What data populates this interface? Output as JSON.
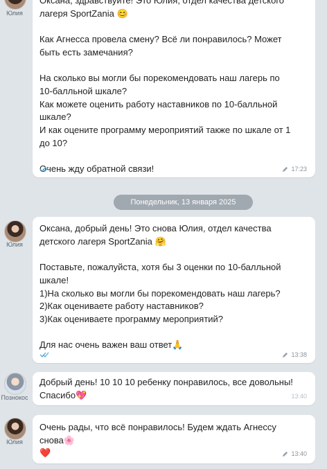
{
  "messages": [
    {
      "author": "Юлия",
      "text": "Оксана, здравствуйте! Это Юлия, отдел качества детского\nлагеря SportZania 😊\n\nКак Агнесса провела смену? Всё ли понравилось? Может\nбыть есть замечания?\n\nНа сколько вы могли бы порекомендовать наш лагерь по\n10-балльной шкале?\nКак можете оценить работу наставников по 10-балльной\nшкале?\nИ как оцените программу мероприятий также по шкале от 1\nдо 10?\n\nОчень жду обратной связи!",
      "time": "17:23"
    },
    {
      "author": "Юлия",
      "text": "Оксана, добрый день! Это снова Юлия, отдел качества\nдетского лагеря SportZania 🤗\n\nПоставьте, пожалуйста, хотя бы 3 оценки по 10-балльной\nшкале!\n1)На сколько вы могли бы порекомендовать наш лагерь?\n2)Как оцениваете работу наставников?\n3)Как оцениваете программу мероприятий?\n\nДля нас очень важен ваш ответ🙏",
      "time": "13:38"
    },
    {
      "author": "Познокос",
      "text": "Добрый день! 10 10 10 ребенку понравилось, все довольны!\nСпасибо💖",
      "time": "13:40"
    },
    {
      "author": "Юлия",
      "text": "Очень рады, что всё понравилось! Будем ждать Агнессу\nснова🌸\n❤️",
      "time": "13:40"
    }
  ],
  "date_separator": "Понедельник, 13 января 2025",
  "colors": {
    "background": "#dfe4e8",
    "bubble": "#ffffff",
    "tick": "#5aa9d8",
    "date_pill": "#a0a8b0"
  },
  "icons": [
    "double-check-icon",
    "pencil-icon",
    "avatar"
  ]
}
